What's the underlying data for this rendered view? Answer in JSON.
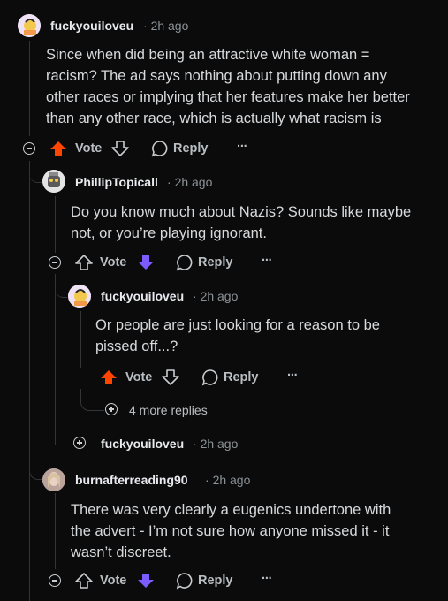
{
  "colors": {
    "upvote_active": "#ff4500",
    "downvote_active": "#7c5cff",
    "background": "#0b0b0c"
  },
  "comments": [
    {
      "user": "fuckyouiloveu",
      "time": "2h ago",
      "lines": [
        "Since when did being an attractive white woman =",
        "racism? The ad says nothing about putting down any",
        "other races or implying that her features make her better",
        "than any other race, which is actually what racism is"
      ],
      "vote_label": "Vote",
      "reply_label": "Reply",
      "more": "···",
      "vote_state": "upvoted"
    },
    {
      "user": "PhillipTopicall",
      "time": "2h ago",
      "lines": [
        "Do you know much about Nazis? Sounds like maybe",
        "not, or you’re playing ignorant."
      ],
      "vote_label": "Vote",
      "reply_label": "Reply",
      "more": "···",
      "vote_state": "downvoted"
    },
    {
      "user": "fuckyouiloveu",
      "time": "2h ago",
      "lines": [
        "Or people are just looking for a reason to be",
        "pissed off...?"
      ],
      "vote_label": "Vote",
      "reply_label": "Reply",
      "more": "···",
      "vote_state": "upvoted"
    },
    {
      "user": "burnafterreading90",
      "time": "2h ago",
      "lines": [
        "There was very clearly a eugenics undertone with",
        "the advert - I’m not sure how anyone missed it - it",
        "wasn’t discreet."
      ],
      "vote_label": "Vote",
      "reply_label": "Reply",
      "more": "···",
      "vote_state": "downvoted"
    }
  ],
  "more_replies": "4 more replies",
  "collapsed": {
    "user": "fuckyouiloveu",
    "time": "2h ago"
  },
  "dot": "·"
}
